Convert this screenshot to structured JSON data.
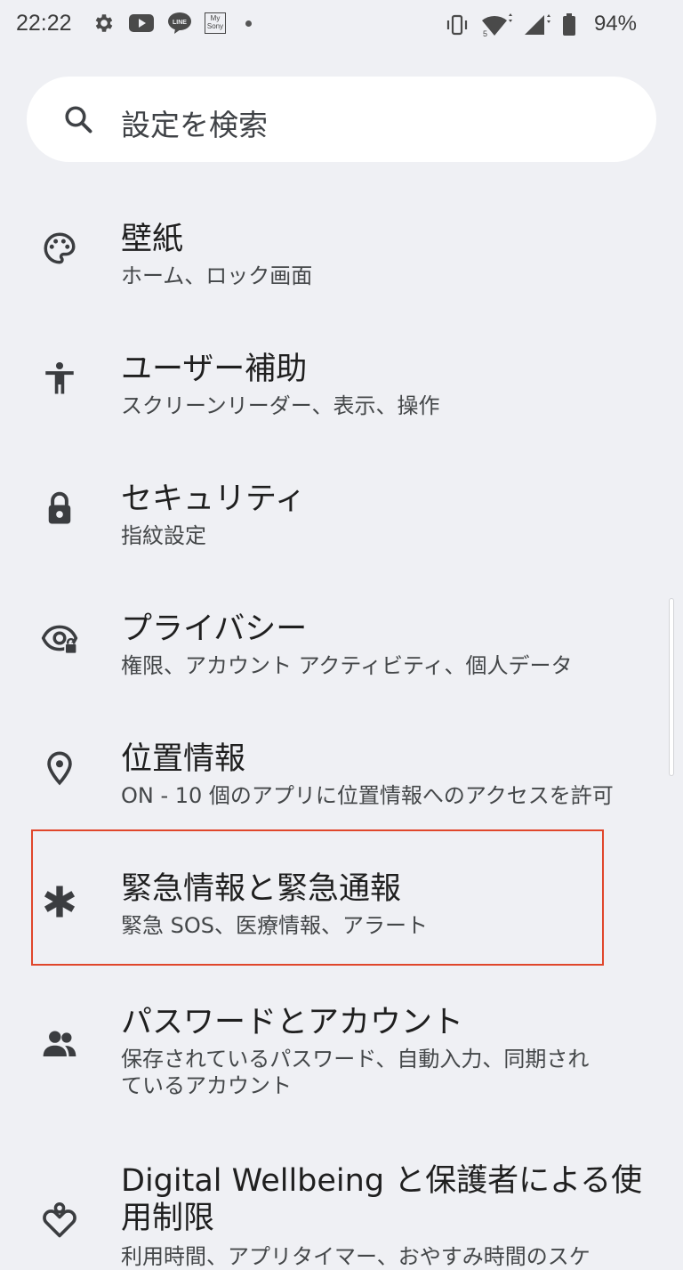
{
  "status_bar": {
    "time": "22:22",
    "notification_icons": [
      "gear-icon",
      "youtube-icon",
      "line-icon",
      "my-sony-icon",
      "dot-icon"
    ],
    "mysony_line1": "My",
    "mysony_line2": "Sony",
    "line_label": "LINE",
    "system_icons": [
      "vibrate-icon",
      "wifi-icon",
      "signal-icon",
      "battery-icon"
    ],
    "battery_percent": "94%"
  },
  "search": {
    "placeholder": "設定を検索"
  },
  "settings_items": [
    {
      "title": "壁紙",
      "subtitle": "ホーム、ロック画面",
      "icon": "palette-icon"
    },
    {
      "title": "ユーザー補助",
      "subtitle": "スクリーンリーダー、表示、操作",
      "icon": "accessibility-icon"
    },
    {
      "title": "セキュリティ",
      "subtitle": "指紋設定",
      "icon": "lock-icon"
    },
    {
      "title": "プライバシー",
      "subtitle": "権限、アカウント アクティビティ、個人データ",
      "icon": "privacy-eye-icon"
    },
    {
      "title": "位置情報",
      "subtitle": "ON - 10 個のアプリに位置情報へのアクセスを許可",
      "icon": "location-pin-icon"
    },
    {
      "title": "緊急情報と緊急通報",
      "subtitle": "緊急 SOS、医療情報、アラート",
      "icon": "asterisk-icon"
    },
    {
      "title": "パスワードとアカウント",
      "subtitle_line1": "保存されているパスワード、自動入力、同期され",
      "subtitle_line2": "ているアカウント",
      "icon": "people-icon"
    },
    {
      "title_line1": "Digital Wellbeing と保護者による使",
      "title_line2": "用制限",
      "subtitle": "利用時間、アプリタイマー、おやすみ時間のスケ",
      "icon": "wellbeing-icon"
    }
  ],
  "colors": {
    "background": "#eff0f4",
    "highlight_border": "#e0462b",
    "search_background": "#ffffff"
  }
}
